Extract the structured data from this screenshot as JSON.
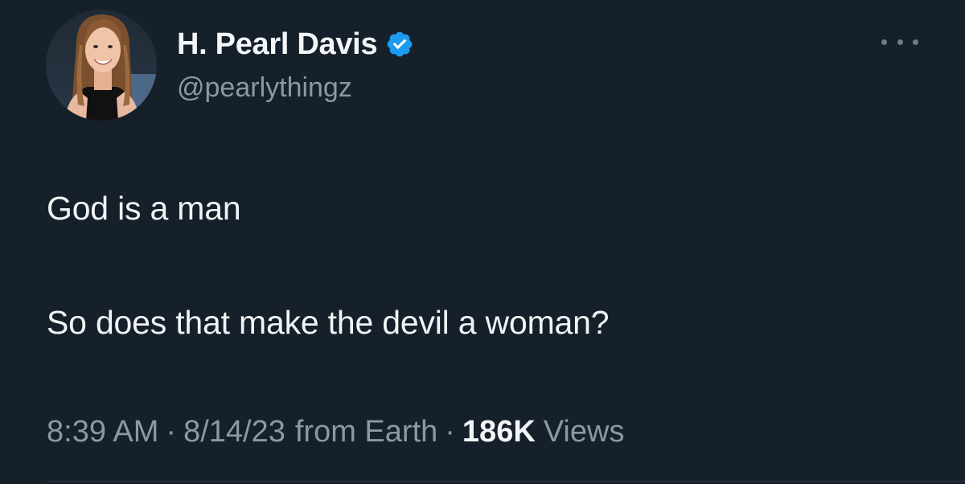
{
  "user": {
    "display_name": "H. Pearl Davis",
    "handle": "@pearlythingz",
    "verified": true,
    "verified_color": "#1d9bf0"
  },
  "tweet": {
    "lines": [
      "God is a man",
      "So does that make the devil a woman?"
    ]
  },
  "meta": {
    "time": "8:39 AM",
    "separator": "·",
    "date": "8/14/23",
    "source": "from Earth",
    "views_count": "186K",
    "views_label": "Views"
  },
  "icons": {
    "avatar": "profile-photo",
    "badge": "verified-badge-icon",
    "more": "more-options-icon"
  },
  "colors": {
    "background": "#15202b",
    "primary_text": "#f3f5f7",
    "secondary_text": "#8b98a5"
  }
}
